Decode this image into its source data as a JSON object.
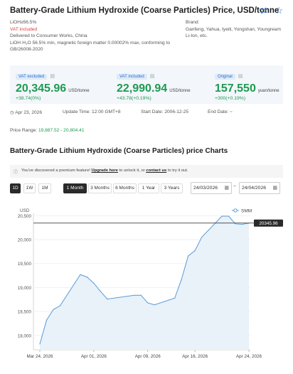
{
  "header": {
    "title": "Battery-Grade Lithium Hydroxide (Coarse Particles) Price, USD/tonne",
    "swap_icon": "swap-icon",
    "star_icon": "star-icon"
  },
  "specs": {
    "line1": "LiOH≥56.5%",
    "vat": "VAT included",
    "line3": "Delivered to Consumer Works, China",
    "line4": "LiOH·H₂O 56.5% min, magnetic foreign matter 0.00002% max, conforming to GB/26008-2020",
    "brand_label": "Brand:",
    "brands": "Ganfeng, Yahua, tyeili, Yongshan, Youngream Li-Ion, etc."
  },
  "prices": [
    {
      "tag": "VAT excluded",
      "value": "20,345.96",
      "unit": "USD/tonne",
      "change": "+38.74(0%)"
    },
    {
      "tag": "VAT included",
      "value": "22,990.94",
      "unit": "USD/tonne",
      "change": "+43.78(+0.19%)"
    },
    {
      "tag": "Original",
      "value": "157,550",
      "unit": "yuan/tonne",
      "change": "+300(+0.19%)"
    }
  ],
  "meta": {
    "date": "Apr 23, 2026",
    "update": "Update Time: 12:00 GMT+8",
    "start": "Start Date: 2006-12-25",
    "end": "End Date: ~"
  },
  "range": {
    "label": "Price Range: ",
    "value": "19,887.52 - 20,804.41"
  },
  "charts_title": "Battery-Grade Lithium Hydroxide (Coarse Particles) price Charts",
  "notice": {
    "prefix": "You've discovered a premium feature! ",
    "link1": "Upgrade here",
    "mid": " to unlock it, or ",
    "link2": "contact us",
    "suffix": " to try it out."
  },
  "controls": {
    "buttons": [
      "1D",
      "1W",
      "1M",
      "1 Month",
      "3 Months",
      "6 Months",
      "1 Year",
      "3 Years"
    ],
    "active": [
      "1D",
      "1 Month"
    ],
    "date_from": "24/03/2026",
    "date_to": "24/04/2026",
    "tilde": "~"
  },
  "chart_data": {
    "type": "area",
    "ylabel": "USD",
    "legend": "SMM",
    "legend_position": "top-right",
    "grid": true,
    "ylim": [
      17700,
      20550
    ],
    "yticks": [
      18000,
      18500,
      19000,
      19500,
      20000,
      20500
    ],
    "ytick_labels": [
      "18,000",
      "18,500",
      "19,000",
      "19,500",
      "20,000",
      "20,500"
    ],
    "xticks": [
      "Mar 24, 2026",
      "Apr 01, 2026",
      "Apr 09, 2026",
      "Apr 16, 2026",
      "Apr 24, 2026"
    ],
    "current_value_label": "20345.96",
    "current_value": 20345.96,
    "color": "#5b9bd5",
    "x": [
      "2026-03-24",
      "2026-03-25",
      "2026-03-26",
      "2026-03-27",
      "2026-03-30",
      "2026-03-31",
      "2026-04-01",
      "2026-04-02",
      "2026-04-03",
      "2026-04-07",
      "2026-04-08",
      "2026-04-09",
      "2026-04-10",
      "2026-04-13",
      "2026-04-14",
      "2026-04-15",
      "2026-04-16",
      "2026-04-17",
      "2026-04-20",
      "2026-04-21",
      "2026-04-22",
      "2026-04-23",
      "2026-04-24"
    ],
    "values": [
      17820,
      18320,
      18540,
      18620,
      19270,
      19220,
      19090,
      18920,
      18760,
      18840,
      18840,
      18680,
      18640,
      18780,
      19170,
      19660,
      19770,
      20050,
      20490,
      20490,
      20330,
      20320,
      20345.96
    ]
  }
}
